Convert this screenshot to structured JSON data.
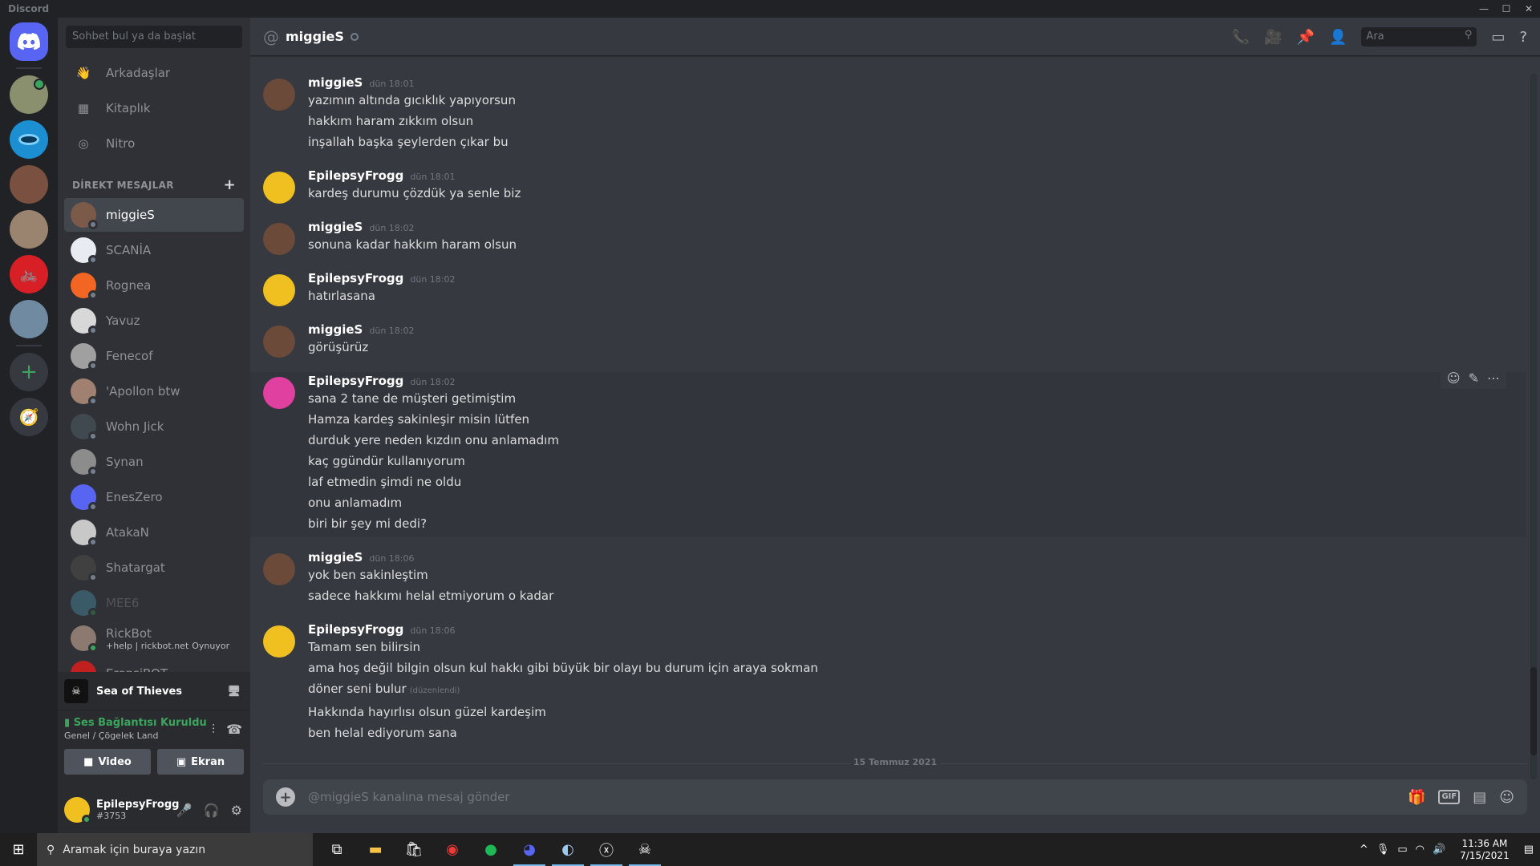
{
  "app_title": "Discord",
  "window_controls": {
    "minimize": "—",
    "maximize": "☐",
    "close": "✕"
  },
  "guilds": [
    {
      "name": "home",
      "color": "#5865f2"
    },
    {
      "name": "server-1",
      "color": "#8a8f6e"
    },
    {
      "name": "server-2",
      "color": "#1b8fd1"
    },
    {
      "name": "server-3",
      "color": "#7a5040"
    },
    {
      "name": "server-4",
      "color": "#9a8470"
    },
    {
      "name": "server-5",
      "color": "#d81f26"
    },
    {
      "name": "server-6",
      "color": "#6f8aa1"
    }
  ],
  "sidebar": {
    "search_placeholder": "Sohbet bul ya da başlat",
    "nav": {
      "friends": "Arkadaşlar",
      "library": "Kitaplık",
      "nitro": "Nitro"
    },
    "dm_header": "DİREKT MESAJLAR",
    "dm_add": "+",
    "dms": [
      {
        "name": "miggieS",
        "color": "#7b5a4a",
        "online": false,
        "active": true
      },
      {
        "name": "SCANİA",
        "color": "#e8ecf2",
        "online": false
      },
      {
        "name": "Rognea",
        "color": "#f26522",
        "online": false
      },
      {
        "name": "Yavuz",
        "color": "#d8d8d8",
        "online": false
      },
      {
        "name": "Fenecof",
        "color": "#a0a0a0",
        "online": false
      },
      {
        "name": "'Apollon btw",
        "color": "#a08070",
        "online": false
      },
      {
        "name": "Wohn Jick",
        "color": "#404850",
        "online": false
      },
      {
        "name": "Synan",
        "color": "#8c8c8c",
        "online": false
      },
      {
        "name": "EnesZero",
        "color": "#5865f2",
        "online": false
      },
      {
        "name": "AtakaN",
        "color": "#c8c8c8",
        "online": false
      },
      {
        "name": "Shatargat",
        "color": "#404040",
        "online": false
      },
      {
        "name": "MEE6",
        "color": "#4fa8c5",
        "online": true,
        "dim": true
      },
      {
        "name": "RickBot",
        "sub_a": "+help | rickbot.net",
        "sub_b": "Oynuyor",
        "color": "#8c7a70",
        "online": true
      },
      {
        "name": "ErensiBOT",
        "color": "#c02020",
        "online": false
      }
    ]
  },
  "game": {
    "name": "Sea of Thieves"
  },
  "voice": {
    "status": "Ses Bağlantısı Kuruldu",
    "channel": "Genel / Çögelek Land",
    "video_label": "Video",
    "screen_label": "Ekran"
  },
  "user": {
    "name": "EpilepsyFrogg",
    "tag": "#3753"
  },
  "chat": {
    "title": "miggieS",
    "search_placeholder": "Ara",
    "messages": [
      {
        "author": "miggieS",
        "time": "dün 18:01",
        "av": "#6b4a3a",
        "lines": [
          "yazımın altında gıcıklık yapıyorsun",
          "hakkım haram zıkkım olsun",
          "inşallah başka şeylerden çıkar bu"
        ]
      },
      {
        "author": "EpilepsyFrogg",
        "time": "dün 18:01",
        "av": "#f0c020",
        "lines": [
          "kardeş durumu çözdük ya senle biz"
        ]
      },
      {
        "author": "miggieS",
        "time": "dün 18:02",
        "av": "#6b4a3a",
        "lines": [
          "sonuna kadar hakkım haram olsun"
        ]
      },
      {
        "author": "EpilepsyFrogg",
        "time": "dün 18:02",
        "av": "#f0c020",
        "lines": [
          "hatırlasana"
        ]
      },
      {
        "author": "miggieS",
        "time": "dün 18:02",
        "av": "#6b4a3a",
        "lines": [
          "görüşürüz"
        ]
      },
      {
        "author": "EpilepsyFrogg",
        "time": "dün 18:02",
        "av": "#e040a0",
        "hl": true,
        "lines": [
          "sana 2 tane de müşteri getimiştim",
          "Hamza kardeş sakinleşir misin lütfen",
          "durduk yere neden kızdın onu anlamadım",
          "kaç ggündür kullanıyorum",
          "laf etmedin şimdi ne oldu",
          "onu anlamadım",
          "biri bir şey mi dedi?"
        ]
      },
      {
        "author": "miggieS",
        "time": "dün 18:06",
        "av": "#6b4a3a",
        "lines": [
          "yok ben sakinleştim",
          "sadece hakkımı helal etmiyorum o kadar"
        ]
      },
      {
        "author": "EpilepsyFrogg",
        "time": "dün 18:06",
        "av": "#f0c020",
        "lines": [
          "Tamam sen bilirsin",
          "ama hoş değil bilgin olsun kul hakkı gibi büyük bir olayı bu durum için araya sokman",
          "döner seni bulur",
          "Hakkında hayırlısı olsun güzel kardeşim",
          "ben helal ediyorum sana"
        ],
        "edited_index": 2,
        "edited_label": "(düzenlendi)"
      }
    ],
    "date_divider": "15 Temmuz 2021",
    "composer_placeholder": "@miggieS kanalına mesaj gönder",
    "gif_label": "GIF"
  },
  "taskbar": {
    "search_placeholder": "Aramak için buraya yazın",
    "time": "11:36 AM",
    "date": "7/15/2021"
  }
}
